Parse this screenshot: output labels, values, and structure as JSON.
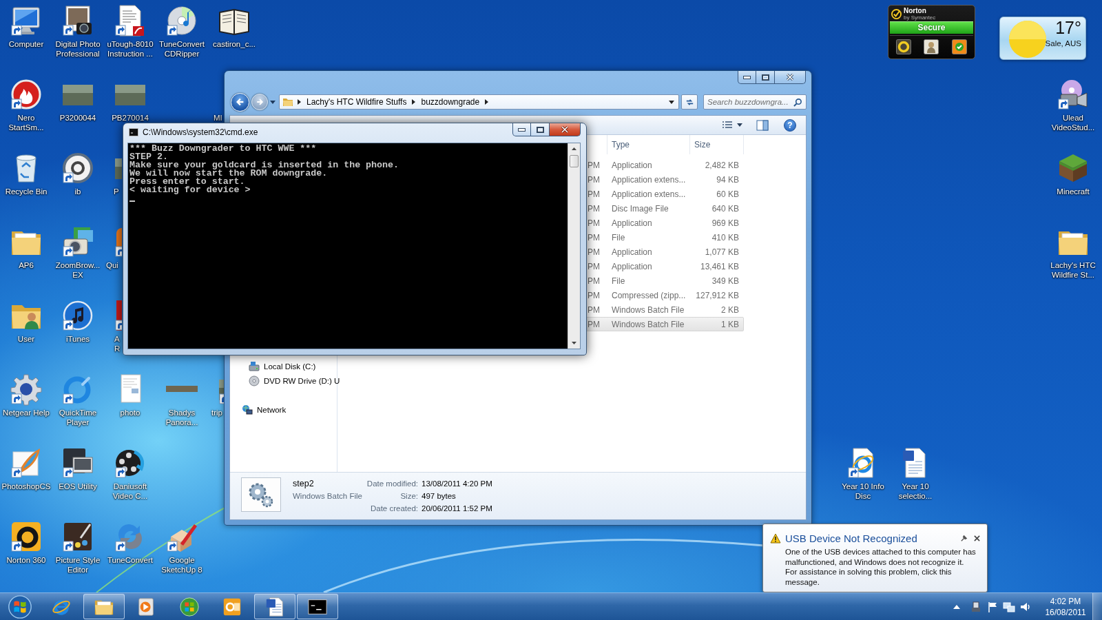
{
  "desktop_icons": [
    {
      "label": "Computer",
      "kind": "computer",
      "shortcut": true
    },
    {
      "label": "Digital Photo Professional",
      "kind": "photo_app",
      "shortcut": true
    },
    {
      "label": "uTough-8010 Instruction ...",
      "kind": "pdf",
      "shortcut": true
    },
    {
      "label": "TuneConvert CDRipper",
      "kind": "disc",
      "shortcut": true
    },
    {
      "label": "castiron_c...",
      "kind": "book",
      "shortcut": false
    },
    {
      "label": "Nero StartSm...",
      "kind": "flame",
      "shortcut": true
    },
    {
      "label": "P3200044",
      "kind": "photo",
      "shortcut": false
    },
    {
      "label": "PB270014",
      "kind": "photo",
      "shortcut": false
    },
    {
      "label": "MI",
      "kind": "hidden",
      "shortcut": false
    },
    {
      "label": "Ulead VideoStud...",
      "kind": "video_camera",
      "shortcut": true
    },
    {
      "label": "Recycle Bin",
      "kind": "recycle_bin",
      "shortcut": false
    },
    {
      "label": "ib",
      "kind": "round_logo",
      "shortcut": true
    },
    {
      "label": "P",
      "kind": "photo",
      "shortcut": false
    },
    {
      "label": "Minecraft",
      "kind": "grass_block",
      "shortcut": false
    },
    {
      "label": "AP6",
      "kind": "folder",
      "shortcut": false
    },
    {
      "label": "ZoomBrow... EX",
      "kind": "camera",
      "shortcut": true
    },
    {
      "label": "Qui",
      "kind": "orange_app",
      "shortcut": true
    },
    {
      "label": "Lachy's HTC Wildfire St...",
      "kind": "folder",
      "shortcut": false
    },
    {
      "label": "User",
      "kind": "user_folder",
      "shortcut": false
    },
    {
      "label": "iTunes",
      "kind": "music",
      "shortcut": true
    },
    {
      "label": "A R",
      "kind": "red_app",
      "shortcut": true
    },
    {
      "label": "Netgear Help",
      "kind": "gear",
      "shortcut": true
    },
    {
      "label": "QuickTime Player",
      "kind": "ring",
      "shortcut": true
    },
    {
      "label": "photo",
      "kind": "document",
      "shortcut": false
    },
    {
      "label": "Shadys Panora...",
      "kind": "panorama",
      "shortcut": false
    },
    {
      "label": "trip",
      "kind": "photo",
      "shortcut": true
    },
    {
      "label": "PhotoshopCS",
      "kind": "feather",
      "shortcut": true
    },
    {
      "label": "EOS Utility",
      "kind": "monitors",
      "shortcut": true
    },
    {
      "label": "Daniusoft Video C...",
      "kind": "reel",
      "shortcut": true
    },
    {
      "label": "Year 10 Info Disc",
      "kind": "e_logo",
      "shortcut": true
    },
    {
      "label": "Year 10 selectio...",
      "kind": "word_doc",
      "shortcut": false
    },
    {
      "label": "Norton 360",
      "kind": "ring_tile",
      "shortcut": true
    },
    {
      "label": "Picture Style Editor",
      "kind": "palette",
      "shortcut": true
    },
    {
      "label": "TuneConvert",
      "kind": "swirl",
      "shortcut": true
    },
    {
      "label": "Google SketchUp 8",
      "kind": "pencil",
      "shortcut": true
    }
  ],
  "norton_gadget": {
    "brand": "Norton",
    "byline": "by Symantec",
    "status": "Secure"
  },
  "weather_gadget": {
    "temperature": "17°",
    "location": "Sale, AUS"
  },
  "explorer": {
    "navigation": {
      "back": {
        "disabled": false
      },
      "forward": {
        "disabled": true
      }
    },
    "breadcrumb": [
      "Lachy's HTC Wildfire Stuffs",
      "buzzdowngrade"
    ],
    "search": {
      "placeholder": "Search buzzdowngra..."
    },
    "toolbar": {
      "help": "?"
    },
    "columns": [
      "Type",
      "Size"
    ],
    "files": [
      {
        "column_1": "PM",
        "type": "Application",
        "size": "2,482 KB",
        "selected": false
      },
      {
        "column_1": "PM",
        "type": "Application extens...",
        "size": "94 KB",
        "selected": false
      },
      {
        "column_1": "PM",
        "type": "Application extens...",
        "size": "60 KB",
        "selected": false
      },
      {
        "column_1": "PM",
        "type": "Disc Image File",
        "size": "640 KB",
        "selected": false
      },
      {
        "column_1": "PM",
        "type": "Application",
        "size": "969 KB",
        "selected": false
      },
      {
        "column_1": "PM",
        "type": "File",
        "size": "410 KB",
        "selected": false
      },
      {
        "column_1": "PM",
        "type": "Application",
        "size": "1,077 KB",
        "selected": false
      },
      {
        "column_1": "PM",
        "type": "Application",
        "size": "13,461 KB",
        "selected": false
      },
      {
        "column_1": "PM",
        "type": "File",
        "size": "349 KB",
        "selected": false
      },
      {
        "column_1": "PM",
        "type": "Compressed (zipp...",
        "size": "127,912 KB",
        "selected": false
      },
      {
        "column_1": "PM",
        "type": "Windows Batch File",
        "size": "2 KB",
        "selected": false
      },
      {
        "column_1": "PM",
        "type": "Windows Batch File",
        "size": "1 KB",
        "selected": true
      }
    ],
    "navigation_pane": [
      {
        "label": "Local Disk (C:)",
        "kind": "disk"
      },
      {
        "label": "DVD RW Drive (D:) U",
        "kind": "dvd"
      },
      {
        "label": "Network",
        "kind": "network"
      }
    ],
    "details": {
      "name": "step2",
      "type": "Windows Batch File",
      "properties": [
        {
          "label": "Date modified:",
          "value": "13/08/2011 4:20 PM"
        },
        {
          "label": "Size:",
          "value": "497 bytes"
        },
        {
          "label": "Date created:",
          "value": "20/06/2011 1:52 PM"
        }
      ]
    }
  },
  "console_window": {
    "title": "C:\\Windows\\system32\\cmd.exe",
    "lines": [
      "*** Buzz Downgrader to HTC WWE ***",
      "STEP 2.",
      "Make sure your goldcard is inserted in the phone.",
      "We will now start the ROM downgrade.",
      "Press enter to start.",
      "< waiting for device >"
    ],
    "cursor": true
  },
  "notification": {
    "title": "USB Device Not Recognized",
    "message": "One of the USB devices attached to this computer has malfunctioned, and Windows does not recognize it.\nFor assistance in solving this problem, click this message."
  },
  "taskbar": {
    "buttons": [
      {
        "kind": "browser",
        "running": false
      },
      {
        "kind": "file_explorer",
        "running": true
      },
      {
        "kind": "media_player",
        "running": false
      },
      {
        "kind": "windows_orb",
        "running": false
      },
      {
        "kind": "mail",
        "running": false
      },
      {
        "kind": "word_processor",
        "running": true
      },
      {
        "kind": "console",
        "running": true
      }
    ],
    "clock": {
      "time": "4:02 PM",
      "date": "16/08/2011"
    }
  }
}
